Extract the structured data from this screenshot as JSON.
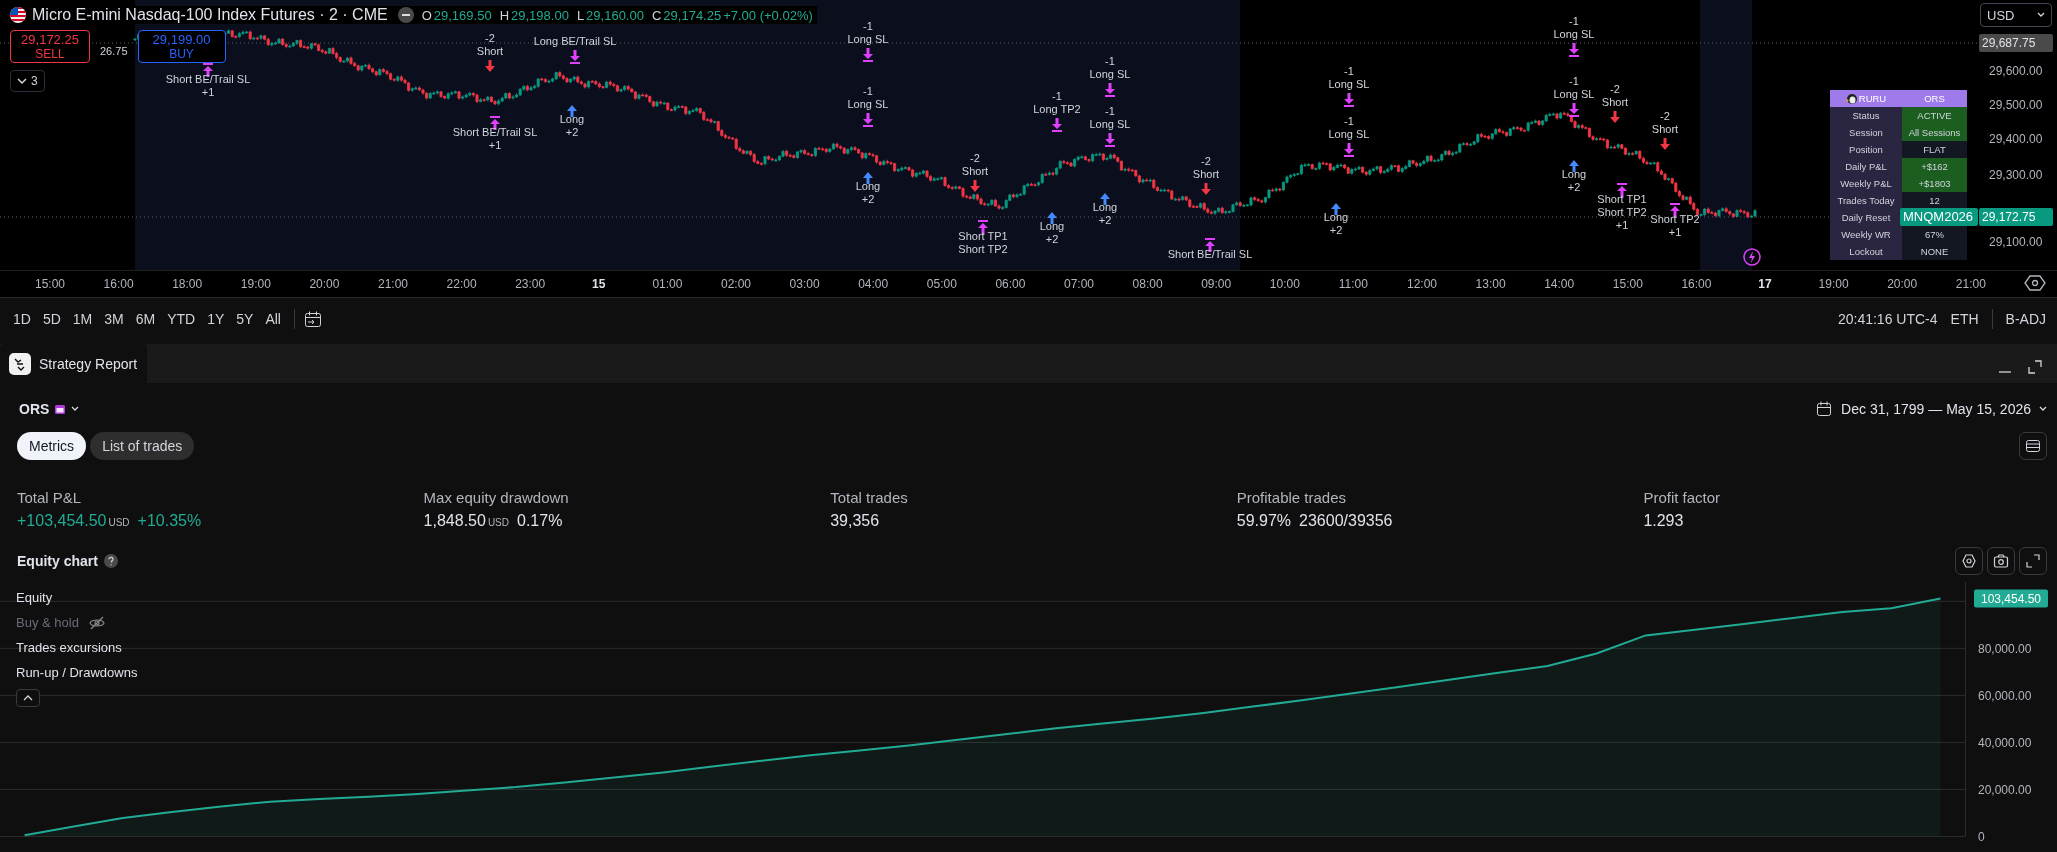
{
  "header": {
    "title": "Micro E-mini Nasdaq-100 Index Futures · 2 · CME",
    "ohlc": [
      {
        "key": "O",
        "value": "29,169.50"
      },
      {
        "key": "H",
        "value": "29,198.00"
      },
      {
        "key": "L",
        "value": "29,160.00"
      },
      {
        "key": "C",
        "value": "29,174.25"
      }
    ],
    "change": "+7.00 (+0.02%)"
  },
  "order_buttons": {
    "sell": {
      "price": "29,172.25",
      "label": "SELL"
    },
    "spread": "26.75",
    "buy": {
      "price": "29,199.00",
      "label": "BUY"
    }
  },
  "indicators_toggle": {
    "count": "3"
  },
  "currency": "USD",
  "info_table": {
    "header": [
      "RURU",
      "ORS"
    ],
    "rows": [
      {
        "label": "Status",
        "value": "ACTIVE",
        "highlight": true
      },
      {
        "label": "Session",
        "value": "All Sessions",
        "highlight": true
      },
      {
        "label": "Position",
        "value": "FLAT",
        "highlight": false
      },
      {
        "label": "Daily P&L",
        "value": "+$162",
        "highlight": true
      },
      {
        "label": "Weekly P&L",
        "value": "+$1803",
        "highlight": true
      },
      {
        "label": "Trades Today",
        "value": "12",
        "highlight": false
      },
      {
        "label": "Daily Reset"
      },
      {
        "label": "Weekly WR",
        "value": "67%",
        "highlight": false
      },
      {
        "label": "Lockout",
        "value": "NONE",
        "highlight": false
      }
    ]
  },
  "price_chart": {
    "price_axis": [
      "29,600.00",
      "29,500.00",
      "29,400.00",
      "29,300.00",
      "29,100.00"
    ],
    "price_tags": [
      {
        "kind": "high",
        "label": "29,687.75"
      },
      {
        "kind": "last",
        "label": "29,172.75",
        "symbol": "MNQM2026"
      }
    ],
    "time_axis": [
      {
        "label": "15:00",
        "day": false
      },
      {
        "label": "16:00",
        "day": false
      },
      {
        "label": "18:00",
        "day": false
      },
      {
        "label": "19:00",
        "day": false
      },
      {
        "label": "20:00",
        "day": false
      },
      {
        "label": "21:00",
        "day": false
      },
      {
        "label": "22:00",
        "day": false
      },
      {
        "label": "23:00",
        "day": false
      },
      {
        "label": "15",
        "day": true
      },
      {
        "label": "01:00",
        "day": false
      },
      {
        "label": "02:00",
        "day": false
      },
      {
        "label": "03:00",
        "day": false
      },
      {
        "label": "04:00",
        "day": false
      },
      {
        "label": "05:00",
        "day": false
      },
      {
        "label": "06:00",
        "day": false
      },
      {
        "label": "07:00",
        "day": false
      },
      {
        "label": "08:00",
        "day": false
      },
      {
        "label": "09:00",
        "day": false
      },
      {
        "label": "10:00",
        "day": false
      },
      {
        "label": "11:00",
        "day": false
      },
      {
        "label": "12:00",
        "day": false
      },
      {
        "label": "13:00",
        "day": false
      },
      {
        "label": "14:00",
        "day": false
      },
      {
        "label": "15:00",
        "day": false
      },
      {
        "label": "16:00",
        "day": false
      },
      {
        "label": "17",
        "day": true
      },
      {
        "label": "19:00",
        "day": false
      },
      {
        "label": "20:00",
        "day": false
      },
      {
        "label": "21:00",
        "day": false
      }
    ],
    "signals": [
      {
        "kind": "short",
        "lines": [
          "-2",
          "Short"
        ]
      },
      {
        "kind": "short_exit",
        "lines": [
          "Short BE/Trail SL",
          "+1"
        ]
      },
      {
        "kind": "short_exit",
        "lines": [
          "Short BE/Trail SL",
          "+1"
        ]
      },
      {
        "kind": "long",
        "lines": [
          "Long",
          "+2"
        ]
      },
      {
        "kind": "long_exit",
        "lines": [
          "Long BE/Trail SL"
        ]
      },
      {
        "kind": "long_exit",
        "lines": [
          "-1",
          "Long SL"
        ]
      },
      {
        "kind": "long_exit",
        "lines": [
          "-1",
          "Long SL"
        ]
      },
      {
        "kind": "long",
        "lines": [
          "Long",
          "+2"
        ]
      },
      {
        "kind": "short",
        "lines": [
          "-2",
          "Short"
        ]
      },
      {
        "kind": "short_exit",
        "lines": [
          "Short TP1",
          "Short TP2"
        ]
      },
      {
        "kind": "long",
        "lines": [
          "Long",
          "+2"
        ]
      },
      {
        "kind": "long_exit",
        "lines": [
          "-1",
          "Long TP2"
        ]
      },
      {
        "kind": "long_exit",
        "lines": [
          "-1",
          "Long SL"
        ]
      },
      {
        "kind": "long_exit",
        "lines": [
          "-1",
          "Long SL"
        ]
      },
      {
        "kind": "long",
        "lines": [
          "Long",
          "+2"
        ]
      },
      {
        "kind": "short",
        "lines": [
          "-2",
          "Short"
        ]
      },
      {
        "kind": "short_exit",
        "lines": [
          "Short BE/Trail SL"
        ]
      },
      {
        "kind": "long_exit",
        "lines": [
          "-1",
          "Long SL"
        ]
      },
      {
        "kind": "long_exit",
        "lines": [
          "-1",
          "Long SL"
        ]
      },
      {
        "kind": "long",
        "lines": [
          "Long",
          "+2"
        ]
      },
      {
        "kind": "long_exit",
        "lines": [
          "-1",
          "Long SL"
        ]
      },
      {
        "kind": "long_exit",
        "lines": [
          "-1",
          "Long SL"
        ]
      },
      {
        "kind": "long",
        "lines": [
          "Long",
          "+2"
        ]
      },
      {
        "kind": "short",
        "lines": [
          "-2",
          "Short"
        ]
      },
      {
        "kind": "short",
        "lines": [
          "-2",
          "Short"
        ]
      },
      {
        "kind": "short_exit",
        "lines": [
          "Short TP1",
          "Short TP2",
          "+1"
        ]
      },
      {
        "kind": "short_exit",
        "lines": [
          "Short TP2",
          "+1"
        ]
      }
    ]
  },
  "range_buttons": [
    "1D",
    "5D",
    "1M",
    "3M",
    "6M",
    "YTD",
    "1Y",
    "5Y",
    "All"
  ],
  "status": {
    "time": "20:41:16 UTC-4",
    "session": "ETH",
    "adjustment": "B-ADJ"
  },
  "report": {
    "tab": "Strategy Report",
    "strategy": "ORS",
    "date_range": "Dec 31, 1799 — May 15, 2026",
    "tabs": [
      {
        "label": "Metrics",
        "selected": true
      },
      {
        "label": "List of trades",
        "selected": false
      }
    ],
    "metrics": [
      {
        "label": "Total P&L",
        "value": "+103,454.50",
        "unit": "USD",
        "extra": "+10.35%",
        "positive": true
      },
      {
        "label": "Max equity drawdown",
        "value": "1,848.50",
        "unit": "USD",
        "extra": "0.17%",
        "positive": false
      },
      {
        "label": "Total trades",
        "value": "39,356",
        "positive": false
      },
      {
        "label": "Profitable trades",
        "value": "59.97%",
        "extra": "23600/39356",
        "positive": false
      },
      {
        "label": "Profit factor",
        "value": "1.293",
        "positive": false
      }
    ],
    "equity_chart": {
      "title": "Equity chart",
      "last_value": "103,454.50",
      "legend": [
        {
          "label": "Buy & hold",
          "visible": false
        },
        {
          "label": "Trades excursions",
          "visible": true
        },
        {
          "label": "Run-up / Drawdowns",
          "visible": true
        }
      ],
      "chart_data": {
        "type": "line",
        "grid": true,
        "ylim": [
          0,
          108000
        ],
        "yticks": [
          {
            "value": 0,
            "label": "0"
          },
          {
            "value": 20000,
            "label": "20,000.00"
          },
          {
            "value": 40000,
            "label": "40,000.00"
          },
          {
            "value": 60000,
            "label": "60,000.00"
          },
          {
            "value": 80000,
            "label": "80,000.00"
          }
        ],
        "series": [
          {
            "name": "Equity",
            "color": "#22ab94",
            "values": [
              300,
              4000,
              7700,
              10200,
              12500,
              14600,
              15700,
              16700,
              17900,
              19400,
              20800,
              22800,
              24900,
              27000,
              29500,
              32000,
              34300,
              36400,
              38500,
              40900,
              43400,
              45800,
              47900,
              50000,
              52300,
              55000,
              57700,
              60600,
              63500,
              66400,
              69400,
              72300,
              77600,
              85300,
              87700,
              90200,
              92700,
              95200,
              96800,
              101000
            ]
          }
        ]
      }
    }
  }
}
